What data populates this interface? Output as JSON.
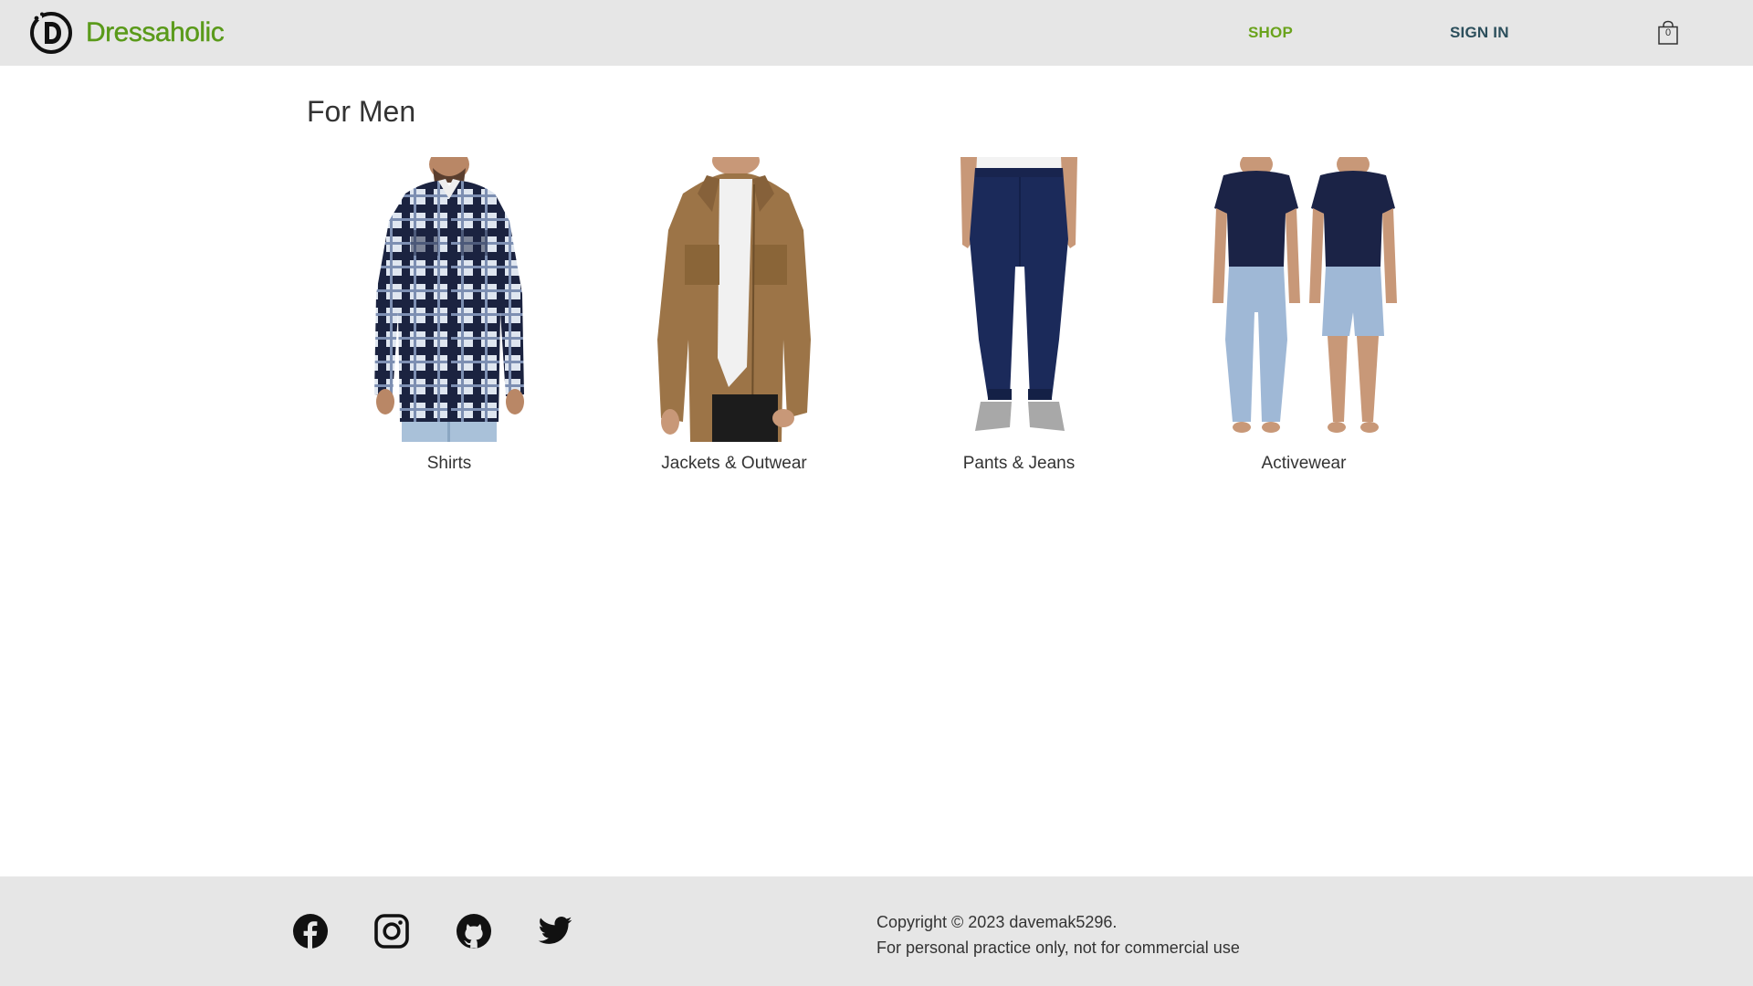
{
  "header": {
    "brand": "Dressaholic",
    "nav": {
      "shop_label": "SHOP",
      "signin_label": "SIGN IN"
    },
    "cart_count": "0"
  },
  "main": {
    "title": "For Men",
    "categories": [
      {
        "label": "Shirts"
      },
      {
        "label": "Jackets & Outwear"
      },
      {
        "label": "Pants & Jeans"
      },
      {
        "label": "Activewear"
      }
    ]
  },
  "footer": {
    "social": [
      "facebook-icon",
      "instagram-icon",
      "github-icon",
      "twitter-icon"
    ],
    "copyright_line1": "Copyright © 2023 davemak5296.",
    "copyright_line2": "For personal practice only, not for commercial use"
  },
  "colors": {
    "header_bg": "#e6e6e6",
    "brand_green": "#5a9a1a",
    "shop_green": "#6aa31c",
    "signin_teal": "#2c4f5c",
    "text": "#333333"
  }
}
